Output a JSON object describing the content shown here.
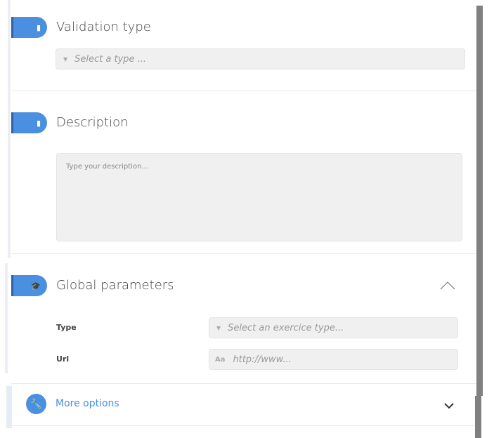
{
  "validation": {
    "title": "Validation type",
    "placeholder": "Select a type ...",
    "icon": "book-icon"
  },
  "description": {
    "title": "Description",
    "placeholder": "Type your description...",
    "icon": "book-icon"
  },
  "global": {
    "title": "Global parameters",
    "icon": "graduation-cap-icon",
    "type_label": "Type",
    "type_placeholder": "Select an exercice type...",
    "url_label": "Url",
    "url_prefix": "Aa",
    "url_placeholder": "http://www..."
  },
  "more": {
    "label": "More options",
    "icon": "wrench-icon"
  },
  "colors": {
    "accent": "#4a8fe0",
    "scrollbar": "#808080"
  }
}
